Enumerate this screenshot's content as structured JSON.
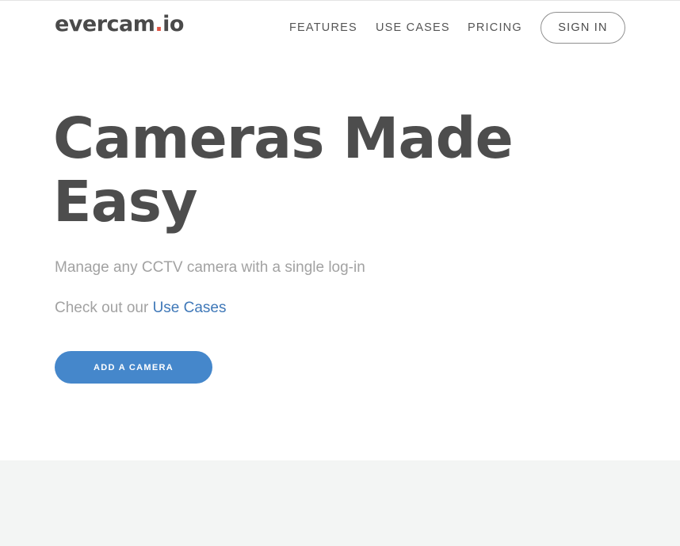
{
  "header": {
    "logo": {
      "text_main": "evercam",
      "text_dot": ".",
      "text_suffix": "io"
    },
    "nav": {
      "features": "FEATURES",
      "use_cases": "USE CASES",
      "pricing": "PRICING"
    },
    "sign_in": "SIGN IN"
  },
  "hero": {
    "title_line1": "Cameras Made",
    "title_line2": "Easy",
    "subtitle": "Manage any CCTV camera with a single log-in",
    "use_cases_prefix": "Check out our ",
    "use_cases_link": "Use Cases",
    "cta": "ADD A CAMERA"
  },
  "colors": {
    "accent": "#4587cb",
    "link": "#3f78b8",
    "logo_dot": "#e05545",
    "heading": "#4d4d4d",
    "muted_text": "#a2a2a2",
    "lower_section_bg": "#f3f5f4"
  }
}
